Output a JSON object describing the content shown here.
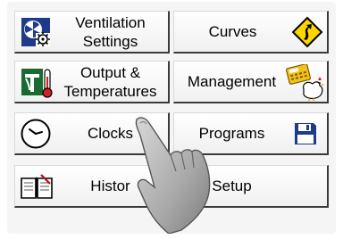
{
  "menu": {
    "ventilation_settings": {
      "line1": "Ventilation",
      "line2": "Settings",
      "icon": "fan-gear-icon"
    },
    "curves": {
      "label": "Curves",
      "icon": "curve-warning-sign-icon"
    },
    "output_temperatures": {
      "line1": "Output &",
      "line2": "Temperatures",
      "icon": "output-thermometer-icon"
    },
    "management": {
      "label": "Management",
      "icon": "calculator-chicken-icon"
    },
    "clocks": {
      "label": "Clocks",
      "icon": "clock-icon"
    },
    "programs": {
      "label": "Programs",
      "icon": "floppy-disk-icon"
    },
    "history": {
      "label": "Histor",
      "icon": "book-icon"
    },
    "setup": {
      "label": "Setup"
    }
  },
  "colors": {
    "icon_blue": "#1e3a8a",
    "icon_green": "#1a6b32",
    "sign_yellow": "#ffd500",
    "thermo_red": "#d42020"
  }
}
